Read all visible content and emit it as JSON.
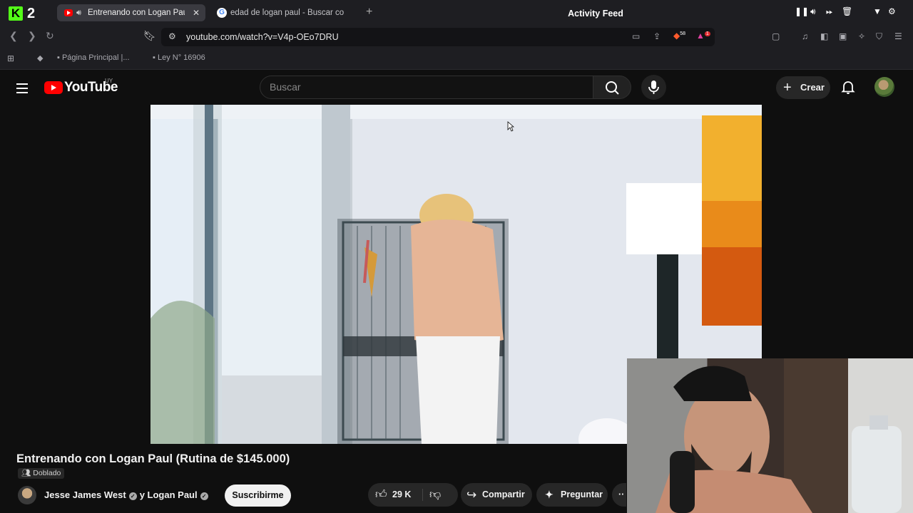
{
  "browser": {
    "app_badge": "2",
    "tabs": [
      {
        "title": "Entrenando con Logan Paul",
        "active": true
      },
      {
        "title": "edad de logan paul - Buscar con G",
        "active": false
      }
    ],
    "new_tab_glyph": "+",
    "activity_feed_label": "Activity Feed",
    "url": "youtube.com/watch?v=V4p-OEo7DRU",
    "extension_badges": {
      "brave_shield": "58",
      "rewards": "1"
    },
    "bookmarks": [
      {
        "label": "Página Principal |..."
      },
      {
        "label": "Ley N° 16906"
      }
    ]
  },
  "youtube": {
    "logo_text": "YouTube",
    "country_code": "UY",
    "search_placeholder": "Buscar",
    "create_label": "Crear",
    "video": {
      "title": "Entrenando con Logan Paul (Rutina de $145.000)",
      "dubbed_badge": "Doblado",
      "channel": "Jesse James West",
      "collab_connector": "y",
      "collab_channel": "Logan Paul",
      "subscribe_label": "Suscribirme",
      "likes": "29 K",
      "share_label": "Compartir",
      "ask_label": "Preguntar"
    }
  },
  "icons": [
    "kick-logo",
    "youtube-favicon",
    "google-favicon",
    "speaker-icon",
    "close-icon",
    "back-icon",
    "forward-icon",
    "reload-icon",
    "bookmark-icon",
    "site-info-icon",
    "cast-icon",
    "share-icon",
    "brave-shield-icon",
    "rewards-icon",
    "menu-icon",
    "search-icon",
    "mic-icon",
    "bell-icon",
    "like-icon",
    "dislike-icon",
    "share-arrow-icon",
    "sparkle-icon",
    "more-icon"
  ],
  "colors": {
    "brand_red": "#ff0000",
    "kick_green": "#53fc18",
    "background": "#0f0f0f",
    "chip": "#272727"
  }
}
